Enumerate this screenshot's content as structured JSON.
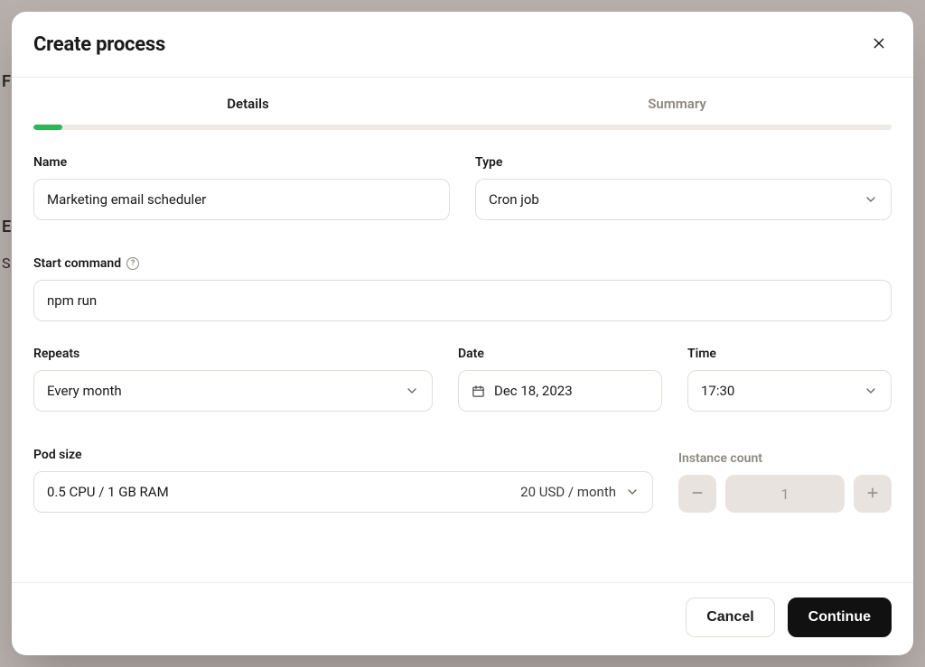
{
  "modal": {
    "title": "Create process",
    "tabs": {
      "details": "Details",
      "summary": "Summary"
    },
    "labels": {
      "name": "Name",
      "type": "Type",
      "start_command": "Start command",
      "repeats": "Repeats",
      "date": "Date",
      "time": "Time",
      "pod_size": "Pod size",
      "instance_count": "Instance count"
    },
    "fields": {
      "name": "Marketing email scheduler",
      "type": "Cron job",
      "start_command": "npm run",
      "repeats": "Every month",
      "date": "Dec 18, 2023",
      "time": "17:30",
      "pod_size_spec": "0.5 CPU / 1 GB RAM",
      "pod_size_price": "20 USD / month",
      "instance_count": "1"
    },
    "footer": {
      "cancel": "Cancel",
      "continue": "Continue"
    }
  }
}
